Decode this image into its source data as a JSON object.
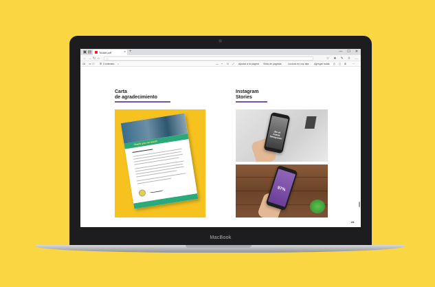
{
  "browser": {
    "tab_title": "Toolkit.pdf",
    "tab_close": "×",
    "new_tab": "+",
    "window_controls": [
      "—",
      "☐",
      "✕"
    ],
    "nav": [
      "←",
      "→",
      "↻",
      "⌂"
    ],
    "address_icon": "ⓘ",
    "toolbar_right": [
      "☆",
      "★",
      "✎",
      "⇪",
      "…"
    ]
  },
  "pdf_toolbar": {
    "page_number": "24",
    "page_total": "de 27",
    "contents_label": "Contenido",
    "search_icon": "search-icon",
    "zoom_out": "—",
    "zoom_in": "+",
    "rotate_icon": "rotate-icon",
    "fit_icon": "fit-icon",
    "read_aloud": "Ajustar a la página",
    "page_view": "Vista de páginas",
    "draw": "Lectura en voz alta",
    "add_note": "Agregar notas",
    "print_icon": "print-icon",
    "save_icon": "save-icon",
    "pin_icon": "pin-icon",
    "more_icon": "more-icon"
  },
  "page": {
    "left_title_1": "Carta",
    "left_title_2": "de agradecimiento",
    "right_title_1": "Instagram",
    "right_title_2": "Stories",
    "letter_headline": "Thank you so much!",
    "story1_text": "¡Es el nuevo Desayuno!",
    "story2_text": "97%",
    "page_number": "24"
  },
  "device": {
    "brand": "MacBook"
  },
  "colors": {
    "background": "#f9d642",
    "accent_underline": "#7b4fa8",
    "letter_band": "#2aa97b",
    "story_purple": "#7b4fa8"
  }
}
